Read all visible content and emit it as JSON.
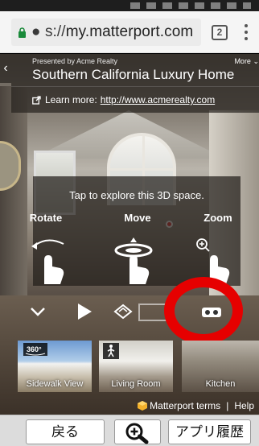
{
  "browser": {
    "url_prefix": "● s://",
    "url_domain": "my.matterport.com",
    "tab_count": "2"
  },
  "header": {
    "presented_by": "Presented by Acme Realty",
    "title": "Southern California Luxury Home",
    "more_label": "More",
    "learn_more_label": "Learn more:",
    "learn_more_link": "http://www.acmerealty.com"
  },
  "help": {
    "tagline": "Tap to explore this 3D space.",
    "rotate": "Rotate",
    "move": "Move",
    "zoom": "Zoom"
  },
  "highlights": [
    {
      "caption": "Sidewalk View",
      "badge": "360°"
    },
    {
      "caption": "Living Room"
    },
    {
      "caption": "Kitchen"
    }
  ],
  "footer": {
    "terms": "Matterport terms",
    "separator": "|",
    "help": "Help"
  },
  "bottom_bar": {
    "back_label": "戻る",
    "history_label": "アプリ履歴"
  },
  "colors": {
    "highlight_ring": "#e60000",
    "target_dot": "#e33333"
  },
  "icons": [
    "lock-icon",
    "tabs-icon",
    "menu-icon",
    "back-chevron-icon",
    "external-link-icon",
    "rotate-gesture-icon",
    "move-gesture-icon",
    "zoom-gesture-icon",
    "collapse-icon",
    "play-icon",
    "dollhouse-icon",
    "floorplan-icon",
    "vr-icon",
    "walk-icon",
    "matterport-logo-icon",
    "zoom-in-icon"
  ]
}
